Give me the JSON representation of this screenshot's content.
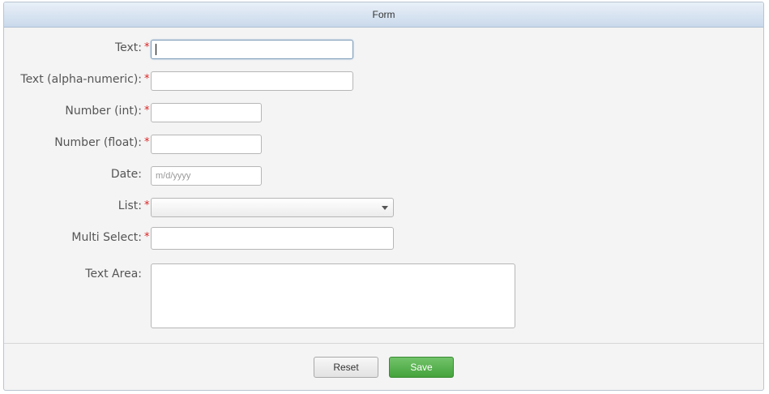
{
  "form": {
    "title": "Form",
    "fields": [
      {
        "label": "Text:",
        "required": true,
        "value": "",
        "placeholder": ""
      },
      {
        "label": "Text (alpha-numeric):",
        "required": true,
        "value": "",
        "placeholder": ""
      },
      {
        "label": "Number (int):",
        "required": true,
        "value": "",
        "placeholder": ""
      },
      {
        "label": "Number (float):",
        "required": true,
        "value": "",
        "placeholder": ""
      },
      {
        "label": "Date:",
        "required": false,
        "value": "",
        "placeholder": "m/d/yyyy"
      },
      {
        "label": "List:",
        "required": true,
        "value": "",
        "placeholder": ""
      },
      {
        "label": "Multi Select:",
        "required": true,
        "value": "",
        "placeholder": ""
      },
      {
        "label": "Text Area:",
        "required": false,
        "value": "",
        "placeholder": ""
      }
    ],
    "required_marker": "*",
    "buttons": {
      "reset_label": "Reset",
      "save_label": "Save"
    }
  },
  "colors": {
    "required": "#dd2222",
    "save_button": "#4caf45",
    "header": "#c9d9eb"
  }
}
